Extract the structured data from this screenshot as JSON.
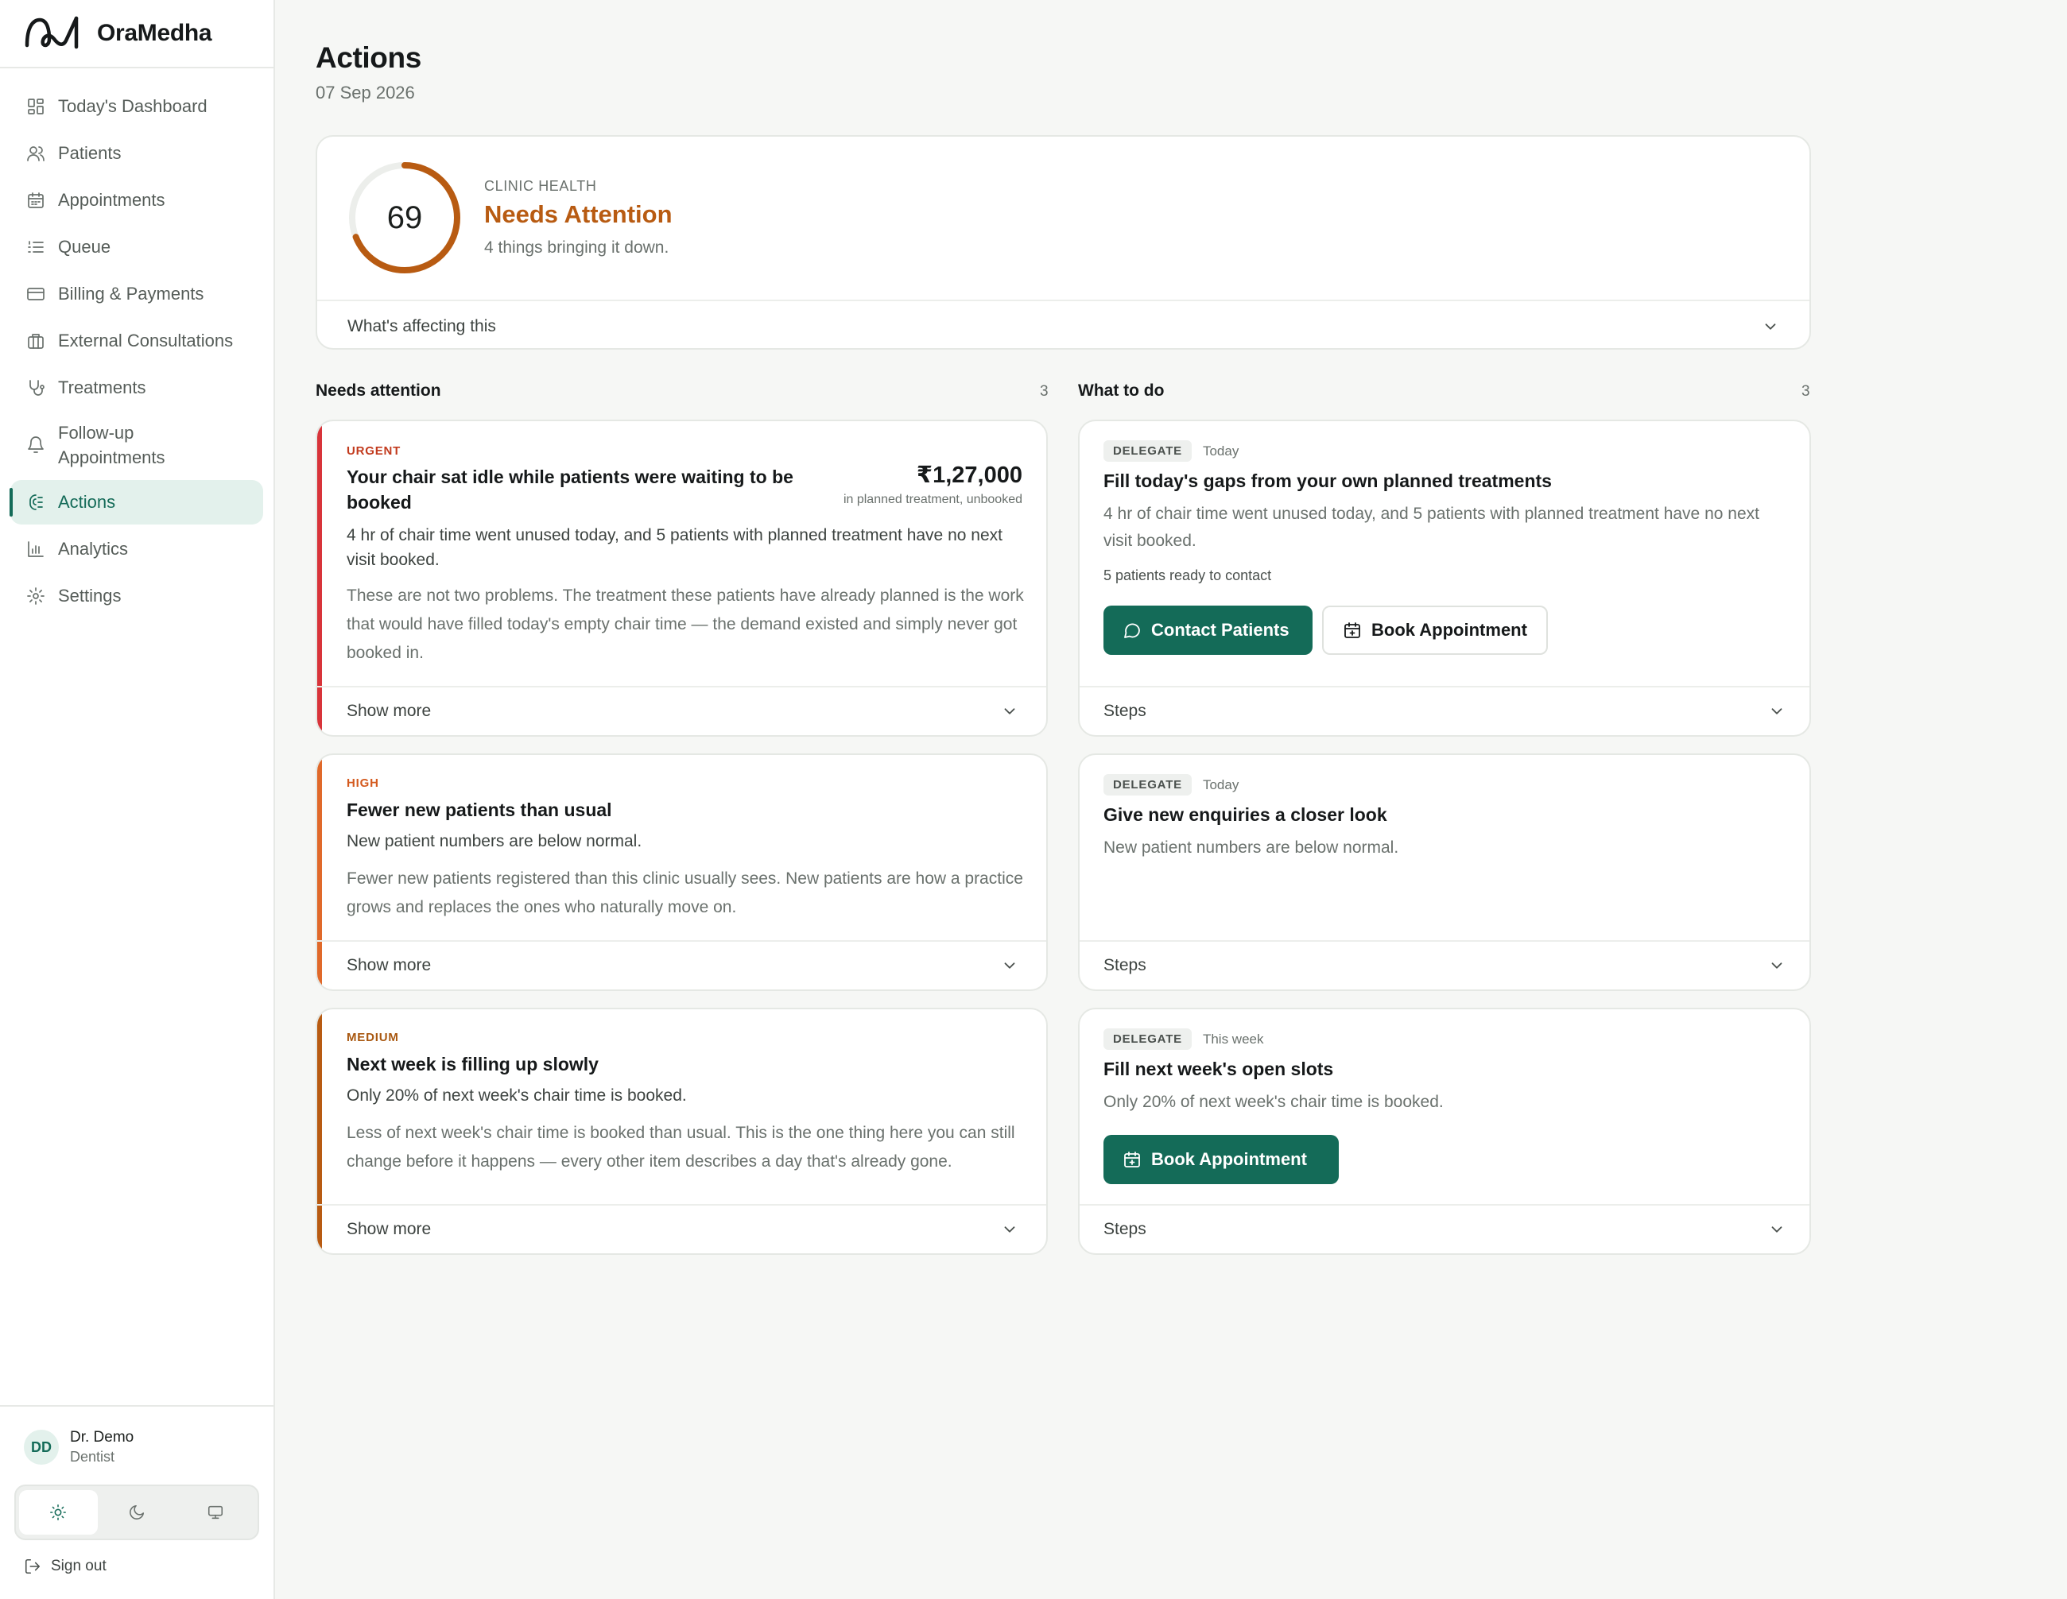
{
  "app": {
    "name": "OraMedha"
  },
  "sidebar": {
    "items": [
      {
        "label": "Today's Dashboard",
        "icon": "dashboard-icon"
      },
      {
        "label": "Patients",
        "icon": "users-icon"
      },
      {
        "label": "Appointments",
        "icon": "calendar-icon"
      },
      {
        "label": "Queue",
        "icon": "list-icon"
      },
      {
        "label": "Billing & Payments",
        "icon": "card-icon"
      },
      {
        "label": "External Consultations",
        "icon": "building-icon"
      },
      {
        "label": "Treatments",
        "icon": "stethoscope-icon"
      },
      {
        "label": "Follow-up Appointments",
        "icon": "bell-icon"
      },
      {
        "label": "Actions",
        "icon": "actions-icon",
        "active": true
      },
      {
        "label": "Analytics",
        "icon": "chart-icon"
      },
      {
        "label": "Settings",
        "icon": "gear-icon"
      }
    ]
  },
  "user": {
    "initials": "DD",
    "name": "Dr. Demo",
    "role": "Dentist",
    "theme_selected": "light",
    "sign_out": "Sign out"
  },
  "page": {
    "title": "Actions",
    "date": "07 Sep 2026"
  },
  "health": {
    "score": "69",
    "score_fraction": 0.69,
    "label": "CLINIC HEALTH",
    "status": "Needs Attention",
    "subtitle": "4 things bringing it down.",
    "toggle": "What's affecting this"
  },
  "colors": {
    "accent": "#146b58",
    "urgent": "#d8343a",
    "high": "#e0692a",
    "medium": "#b85b12",
    "health_ring": "#b85b12"
  },
  "attention": {
    "heading": "Needs attention",
    "count": "3",
    "cards": [
      {
        "severity": "URGENT",
        "title": "Your chair sat idle while patients were waiting to be booked",
        "amount": "₹1,27,000",
        "amount_label": "in planned treatment, unbooked",
        "lead": "4 hr of chair time went unused today, and 5 patients with planned treatment have no next visit booked.",
        "body": "These are not two problems. The treatment these patients have already planned is the work that would have filled today's empty chair time — the demand existed and simply never got booked in.",
        "footer": "Show more"
      },
      {
        "severity": "HIGH",
        "title": "Fewer new patients than usual",
        "lead": "New patient numbers are below normal.",
        "body": "Fewer new patients registered than this clinic usually sees. New patients are how a practice grows and replaces the ones who naturally move on.",
        "footer": "Show more"
      },
      {
        "severity": "MEDIUM",
        "title": "Next week is filling up slowly",
        "lead": "Only 20% of next week's chair time is booked.",
        "body": "Less of next week's chair time is booked than usual. This is the one thing here you can still change before it happens — every other item describes a day that's already gone.",
        "footer": "Show more"
      }
    ]
  },
  "todo": {
    "heading": "What to do",
    "count": "3",
    "cards": [
      {
        "tag": "DELEGATE",
        "when": "Today",
        "title": "Fill today's gaps from your own planned treatments",
        "body": "4 hr of chair time went unused today, and 5 patients with planned treatment have no next visit booked.",
        "note": "5 patients ready to contact",
        "primary": "Contact Patients",
        "secondary": "Book Appointment",
        "footer": "Steps"
      },
      {
        "tag": "DELEGATE",
        "when": "Today",
        "title": "Give new enquiries a closer look",
        "body": "New patient numbers are below normal.",
        "footer": "Steps"
      },
      {
        "tag": "DELEGATE",
        "when": "This week",
        "title": "Fill next week's open slots",
        "body": "Only 20% of next week's chair time is booked.",
        "primary": "Book Appointment",
        "footer": "Steps"
      }
    ]
  }
}
